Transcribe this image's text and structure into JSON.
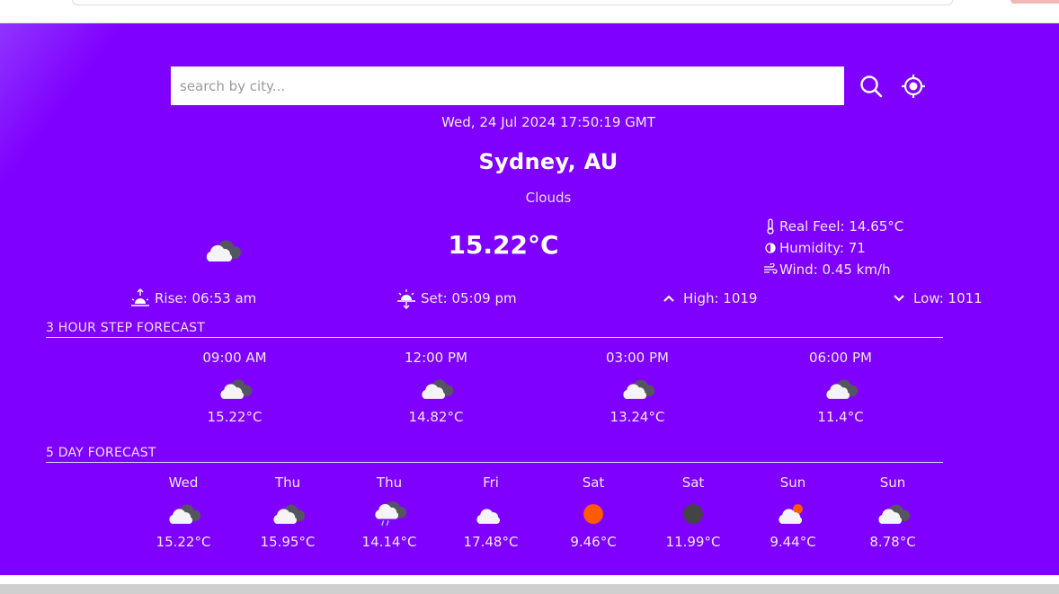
{
  "search": {
    "placeholder": "search by city..."
  },
  "header": {
    "datetime": "Wed, 24 Jul 2024 17:50:19 GMT",
    "city": "Sydney, AU",
    "condition": "Clouds"
  },
  "current": {
    "temp": "15.22°C",
    "icon": "cloud-icon",
    "real_feel": "Real Feel: 14.65°C",
    "humidity": "Humidity: 71",
    "wind": "Wind: 0.45 km/h",
    "rise": "Rise: 06:53 am",
    "set": "Set: 05:09 pm",
    "high": "High: 1019",
    "low": "Low: 1011"
  },
  "hourly": {
    "title": "3 HOUR STEP FORECAST",
    "items": [
      {
        "time": "09:00 AM",
        "temp": "15.22°C",
        "icon": "cloud-icon"
      },
      {
        "time": "12:00 PM",
        "temp": "14.82°C",
        "icon": "cloud-icon"
      },
      {
        "time": "03:00 PM",
        "temp": "13.24°C",
        "icon": "cloud-icon"
      },
      {
        "time": "06:00 PM",
        "temp": "11.4°C",
        "icon": "cloud-icon"
      }
    ]
  },
  "daily": {
    "title": "5 DAY FORECAST",
    "items": [
      {
        "day": "Wed",
        "temp": "15.22°C",
        "icon": "cloud-icon"
      },
      {
        "day": "Thu",
        "temp": "15.95°C",
        "icon": "cloud-icon"
      },
      {
        "day": "Thu",
        "temp": "14.14°C",
        "icon": "rain-cloud-icon"
      },
      {
        "day": "Fri",
        "temp": "17.48°C",
        "icon": "white-cloud-icon"
      },
      {
        "day": "Sat",
        "temp": "9.46°C",
        "icon": "sun-icon"
      },
      {
        "day": "Sat",
        "temp": "11.99°C",
        "icon": "moon-icon"
      },
      {
        "day": "Sun",
        "temp": "9.44°C",
        "icon": "cloud-sun-icon"
      },
      {
        "day": "Sun",
        "temp": "8.78°C",
        "icon": "cloud-icon"
      }
    ]
  },
  "colors": {
    "background": "#7f00ff",
    "text": "#ffffff",
    "sun": "#ff5a00",
    "moon": "#444444"
  }
}
